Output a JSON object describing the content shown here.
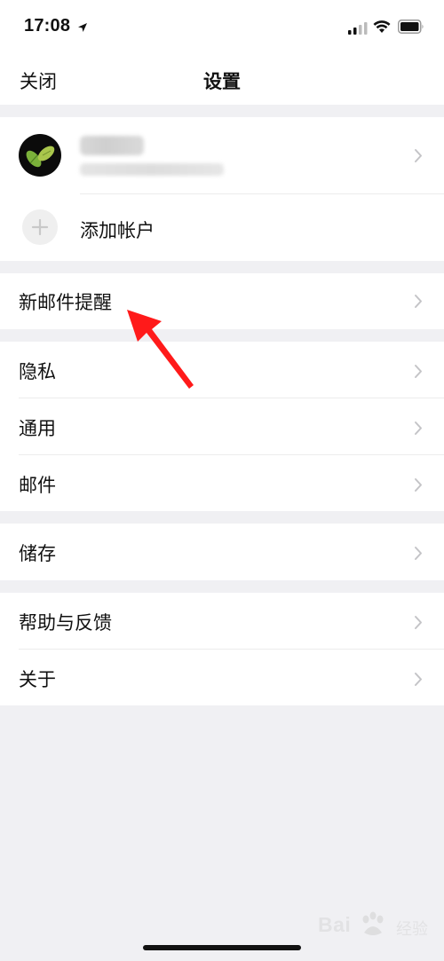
{
  "status_bar": {
    "time": "17:08"
  },
  "nav": {
    "close_label": "关闭",
    "title": "设置"
  },
  "account": {
    "add_account_label": "添加帐户"
  },
  "menu": {
    "new_mail_alert": "新邮件提醒",
    "privacy": "隐私",
    "general": "通用",
    "mail": "邮件",
    "storage": "储存",
    "help_feedback": "帮助与反馈",
    "about": "关于"
  },
  "watermark": {
    "brand": "Bai",
    "suffix": "经验"
  },
  "colors": {
    "background": "#f0f0f3",
    "annotation_arrow": "#ff1a1a",
    "chevron": "#c4c4c7"
  }
}
